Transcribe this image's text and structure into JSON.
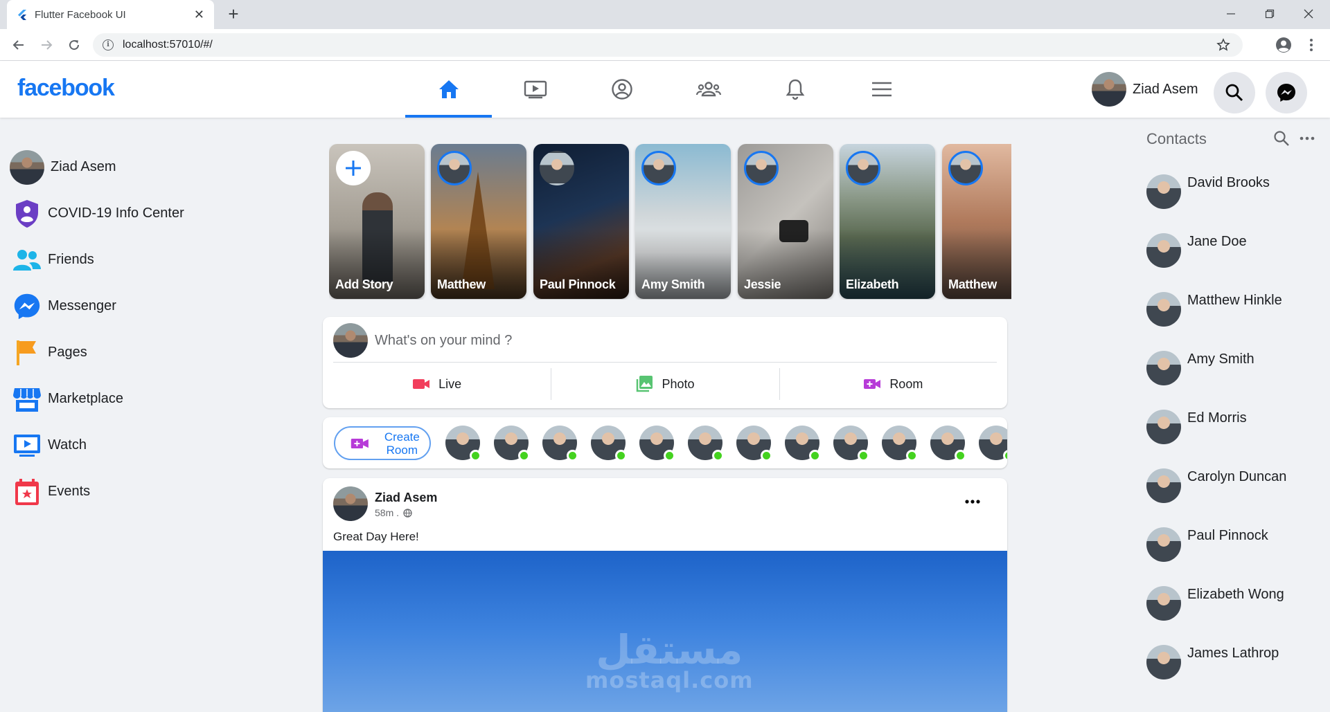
{
  "browser": {
    "tab_title": "Flutter Facebook UI",
    "url": "localhost:57010/#/"
  },
  "appbar": {
    "logo": "facebook",
    "user_name": "Ziad Asem",
    "nav_tabs": [
      "home-icon",
      "watch-icon",
      "profile-icon",
      "groups-icon",
      "bell-icon",
      "menu-icon"
    ],
    "active_tab": "home-icon"
  },
  "left_menu": {
    "user_name": "Ziad Asem",
    "items": [
      {
        "label": "COVID-19 Info Center",
        "icon": "shield-icon"
      },
      {
        "label": "Friends",
        "icon": "friends-icon"
      },
      {
        "label": "Messenger",
        "icon": "messenger-icon"
      },
      {
        "label": "Pages",
        "icon": "flag-icon"
      },
      {
        "label": "Marketplace",
        "icon": "storefront-icon"
      },
      {
        "label": "Watch",
        "icon": "video-icon"
      },
      {
        "label": "Events",
        "icon": "calendar-icon"
      }
    ]
  },
  "stories": [
    {
      "name": "Add Story",
      "is_add": true
    },
    {
      "name": "Matthew"
    },
    {
      "name": "Paul Pinnock"
    },
    {
      "name": "Amy Smith"
    },
    {
      "name": "Jessie"
    },
    {
      "name": "Elizabeth"
    },
    {
      "name": "Matthew"
    }
  ],
  "composer": {
    "placeholder": "What's on your mind ?",
    "actions": [
      {
        "label": "Live",
        "icon": "videocam-icon",
        "color": "#f23e5c"
      },
      {
        "label": "Photo",
        "icon": "photo-library-icon",
        "color": "#58c472"
      },
      {
        "label": "Room",
        "icon": "video-call-icon",
        "color": "#b73bd8"
      }
    ]
  },
  "rooms": {
    "create_label": "Create Room",
    "online_count": 12
  },
  "post": {
    "author": "Ziad Asem",
    "time": "58m .",
    "caption": "Great Day Here!"
  },
  "watermark": {
    "arabic": "مستقل",
    "latin": "mostaql.com"
  },
  "contacts": {
    "title": "Contacts",
    "items": [
      "David Brooks",
      "Jane Doe",
      "Matthew Hinkle",
      "Amy Smith",
      "Ed Morris",
      "Carolyn Duncan",
      "Paul Pinnock",
      "Elizabeth Wong",
      "James Lathrop"
    ]
  },
  "colors": {
    "brand": "#1777f2",
    "online": "#44d21f",
    "background": "#f0f2f5"
  }
}
